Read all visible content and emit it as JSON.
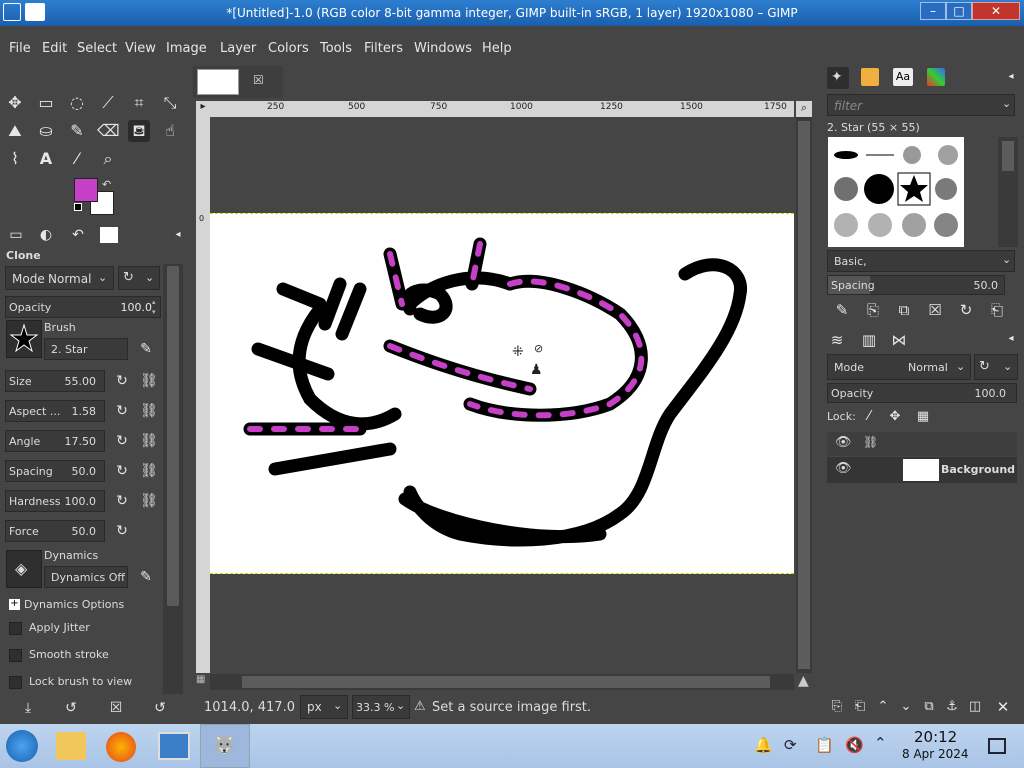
{
  "window": {
    "title": "*[Untitled]-1.0 (RGB color 8-bit gamma integer, GIMP built-in sRGB, 1 layer) 1920x1080 – GIMP",
    "minimize": "–",
    "maximize": "□",
    "close": "✕"
  },
  "menu": [
    "File",
    "Edit",
    "Select",
    "View",
    "Image",
    "Layer",
    "Colors",
    "Tools",
    "Filters",
    "Windows",
    "Help"
  ],
  "colors": {
    "foreground": "#c63fc7",
    "background": "#ffffff",
    "accent": "#1a5fae"
  },
  "tool_options": {
    "title": "Clone",
    "mode_label": "Mode",
    "mode_value": "Normal",
    "opacity_label": "Opacity",
    "opacity_value": "100.0",
    "brush_label": "Brush",
    "brush_value": "2. Star",
    "size_label": "Size",
    "size_value": "55.00",
    "aspect_label": "Aspect ...",
    "aspect_value": "1.58",
    "angle_label": "Angle",
    "angle_value": "17.50",
    "spacing_label": "Spacing",
    "spacing_value": "50.0",
    "hardness_label": "Hardness",
    "hardness_value": "100.0",
    "force_label": "Force",
    "force_value": "50.0",
    "dynamics_label": "Dynamics",
    "dynamics_value": "Dynamics Off",
    "dynamics_options": "Dynamics Options",
    "apply_jitter": "Apply Jitter",
    "smooth_stroke": "Smooth stroke",
    "lock_brush": "Lock brush to view"
  },
  "rulers": {
    "top": [
      "250",
      "500",
      "750",
      "1000",
      "1250",
      "1500",
      "1750"
    ],
    "left": [
      "0"
    ]
  },
  "status": {
    "coords": "1014.0, 417.0",
    "unit": "px",
    "zoom": "33.3 %",
    "message": "Set a source image first."
  },
  "brushes_panel": {
    "filter_placeholder": "filter",
    "selected": "2. Star (55 × 55)",
    "tag": "Basic,",
    "spacing_label": "Spacing",
    "spacing_value": "50.0"
  },
  "layers_panel": {
    "mode_label": "Mode",
    "mode_value": "Normal",
    "opacity_label": "Opacity",
    "opacity_value": "100.0",
    "lock_label": "Lock:",
    "layers": [
      {
        "name": "Background"
      }
    ]
  },
  "taskbar": {
    "time": "20:12",
    "date": "8 Apr 2024"
  }
}
